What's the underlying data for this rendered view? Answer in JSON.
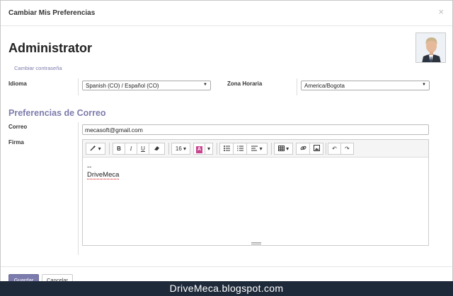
{
  "dialog": {
    "title": "Cambiar Mis Preferencias",
    "close_glyph": "×"
  },
  "user": {
    "name": "Administrator",
    "change_password": "Cambiar contraseña",
    "avatar_icon": "user-portrait-icon"
  },
  "fields": {
    "language_label": "Idioma",
    "language_value": "Spanish (CO) / Español (CO)",
    "timezone_label": "Zona Horaria",
    "timezone_value": "America/Bogota",
    "email_section": "Preferencias de Correo",
    "email_label": "Correo",
    "email_value": "mecasoft@gmail.com",
    "signature_label": "Firma"
  },
  "editor": {
    "toolbar": {
      "style": "wand-icon",
      "bold": "B",
      "italic": "I",
      "underline": "U",
      "eraser": "eraser-icon",
      "font_size": "16",
      "color": "A",
      "ul": "unordered-list-icon",
      "ol": "ordered-list-icon",
      "align": "align-icon",
      "table": "table-icon",
      "link": "link-icon",
      "picture": "picture-icon",
      "undo": "undo-icon",
      "redo": "redo-icon"
    },
    "content": {
      "line1": "--",
      "line2": "DriveMeca"
    }
  },
  "buttons": {
    "save": "Guardar",
    "cancel": "Cancelar"
  },
  "watermark": "DriveMeca.blogspot.com",
  "colors": {
    "accent": "#7c7bad",
    "watermark_bg": "#1e2a3a"
  }
}
